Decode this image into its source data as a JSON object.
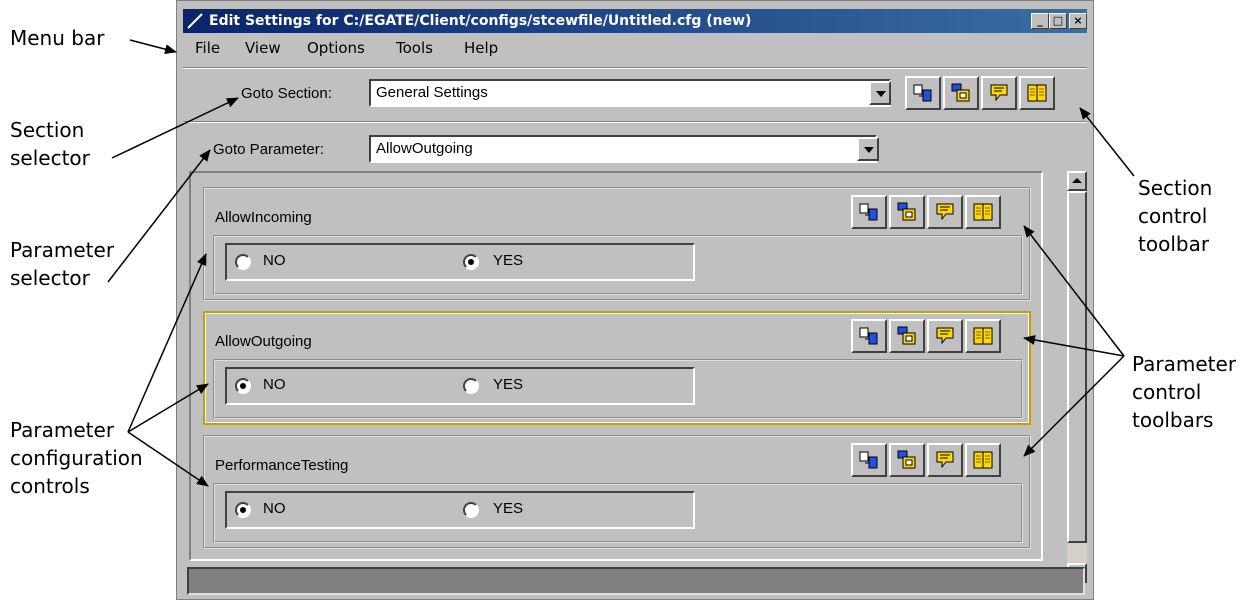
{
  "callouts": {
    "menu_bar": "Menu bar",
    "section_selector": [
      "Section",
      "selector"
    ],
    "parameter_selector": [
      "Parameter",
      "selector"
    ],
    "parameter_configuration_controls": [
      "Parameter",
      "configuration",
      "controls"
    ],
    "section_control_toolbar": [
      "Section",
      "control",
      "toolbar"
    ],
    "parameter_control_toolbars": [
      "Parameter",
      "control",
      "toolbars"
    ]
  },
  "window": {
    "title": "Edit Settings for C:/EGATE/Client/configs/stcewfile/Untitled.cfg (new)",
    "controls": {
      "minimize": "_",
      "maximize": "□",
      "close": "×"
    }
  },
  "menu": [
    "File",
    "View",
    "Options",
    "Tools",
    "Help"
  ],
  "goto_section": {
    "label": "Goto Section:",
    "value": "General Settings"
  },
  "goto_parameter": {
    "label": "Goto Parameter:",
    "value": "AllowOutgoing"
  },
  "toolbar_icons": [
    "copy-icon",
    "paste-icon",
    "comment-icon",
    "book-icon"
  ],
  "parameters": [
    {
      "name": "AllowIncoming",
      "options": [
        "NO",
        "YES"
      ],
      "selected": "YES",
      "highlighted": false
    },
    {
      "name": "AllowOutgoing",
      "options": [
        "NO",
        "YES"
      ],
      "selected": "NO",
      "highlighted": true
    },
    {
      "name": "PerformanceTesting",
      "options": [
        "NO",
        "YES"
      ],
      "selected": "NO",
      "highlighted": false
    }
  ],
  "status": {
    "text": ""
  },
  "colors": {
    "face": "#c0c0c0",
    "title_start": "#0a246a",
    "title_end": "#3a6ea5",
    "highlight_border": "#c8a000",
    "status": "#808080"
  }
}
